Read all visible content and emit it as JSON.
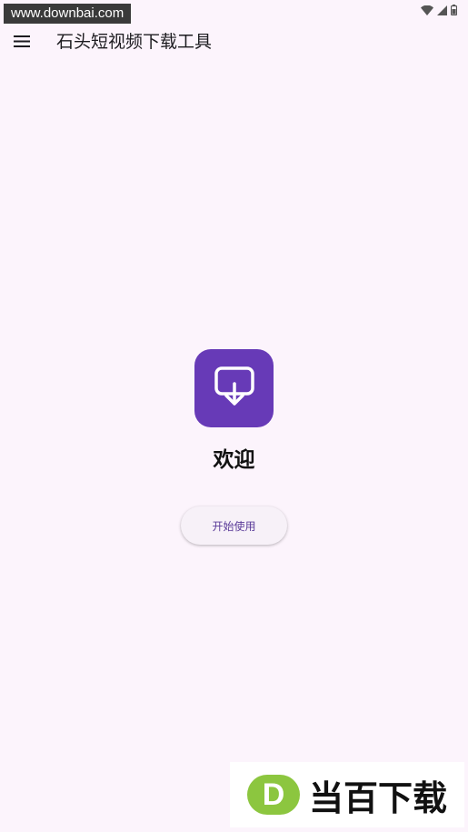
{
  "status_bar": {
    "watermark_text": "www.downbai.com",
    "icons": [
      "wifi-icon",
      "signal-icon",
      "battery-icon"
    ]
  },
  "app_bar": {
    "menu_icon": "menu-icon",
    "title": "石头短视频下载工具"
  },
  "main": {
    "logo_icon": "download-screen-icon",
    "welcome_text": "欢迎",
    "start_button_label": "开始使用"
  },
  "watermark": {
    "logo_letter": "D",
    "brand_text": "当百下载"
  },
  "colors": {
    "background": "#fcf4fc",
    "accent": "#673ab7",
    "button_text": "#5b3c99",
    "watermark_green": "#8cc63f"
  }
}
